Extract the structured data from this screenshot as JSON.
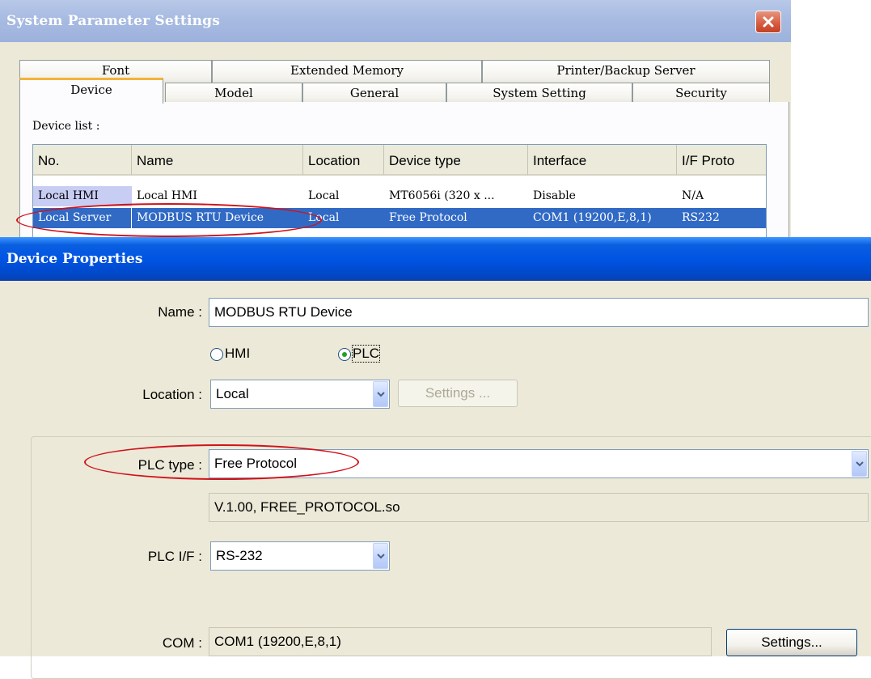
{
  "system_window": {
    "title": "System Parameter Settings",
    "tabs_back": [
      "Font",
      "Extended Memory",
      "Printer/Backup Server"
    ],
    "tabs_front": [
      "Device",
      "Model",
      "General",
      "System Setting",
      "Security"
    ],
    "active_tab": "Device",
    "device_list_label": "Device list :",
    "columns": [
      "No.",
      "Name",
      "Location",
      "Device type",
      "Interface",
      "I/F Proto"
    ],
    "rows": [
      {
        "no": "Local HMI",
        "name": "Local HMI",
        "location": "Local",
        "device_type": "MT6056i (320 x ...",
        "interface": "Disable",
        "protocol": "N/A"
      },
      {
        "no": "Local Server",
        "name": "MODBUS RTU Device",
        "location": "Local",
        "device_type": "Free Protocol",
        "interface": "COM1 (19200,E,8,1)",
        "protocol": "RS232"
      }
    ]
  },
  "device_properties": {
    "title": "Device Properties",
    "name_label": "Name :",
    "name_value": "MODBUS RTU Device",
    "radio_hmi": "HMI",
    "radio_plc": "PLC",
    "selected_radio": "PLC",
    "location_label": "Location :",
    "location_value": "Local",
    "location_settings_btn": "Settings ...",
    "plc_type_label": "PLC type :",
    "plc_type_value": "Free Protocol",
    "plc_version": "V.1.00, FREE_PROTOCOL.so",
    "plc_if_label": "PLC I/F :",
    "plc_if_value": "RS-232",
    "com_label": "COM :",
    "com_value": "COM1 (19200,E,8,1)",
    "com_settings_btn": "Settings..."
  },
  "colors": {
    "selection": "#316ac5",
    "highlight_ellipse": "#d0121b",
    "title_blue": "#0054e3",
    "inactive_title": "#a9bce2"
  },
  "icons": [
    "close-icon",
    "chevron-down-icon"
  ]
}
